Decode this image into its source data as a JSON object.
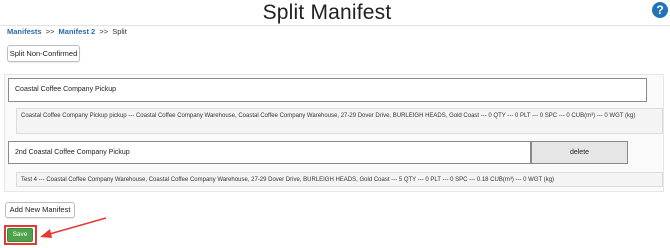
{
  "header": {
    "title": "Split Manifest",
    "help_icon": "question-circle-icon",
    "help_glyph": "?"
  },
  "breadcrumb": {
    "items": [
      "Manifests",
      "Manifest 2"
    ],
    "separator": ">>",
    "current": "Split"
  },
  "toolbar": {
    "split_label": "Split Non-Confirmed"
  },
  "pickups": [
    {
      "name": "Coastal Coffee Company Pickup",
      "detail": "Coastal Coffee Company Pickup pickup --- Coastal Coffee Company Warehouse, Coastal Coffee Company Warehouse, 27-29 Dover Drive, BURLEIGH HEADS, Gold Coast --- 0 QTY --- 0 PLT --- 0 SPC --- 0 CUB(m³) --- 0 WGT (kg)"
    },
    {
      "name": "2nd Coastal Coffee Company Pickup",
      "delete_label": "delete",
      "detail": "Test 4 --- Coastal Coffee Company Warehouse, Coastal Coffee Company Warehouse, 27-29 Dover Drive, BURLEIGH HEADS, Gold Coast --- 5 QTY --- 0 PLT --- 0 SPC --- 0.18 CUB(m³) --- 0 WGT (kg)"
    }
  ],
  "actions": {
    "add_manifest_label": "Add New Manifest",
    "save_label": "Save"
  },
  "colors": {
    "link": "#2a6aa8",
    "save_green": "#4fa24b",
    "highlight_red": "#e53935",
    "help_blue": "#1f73b7"
  }
}
